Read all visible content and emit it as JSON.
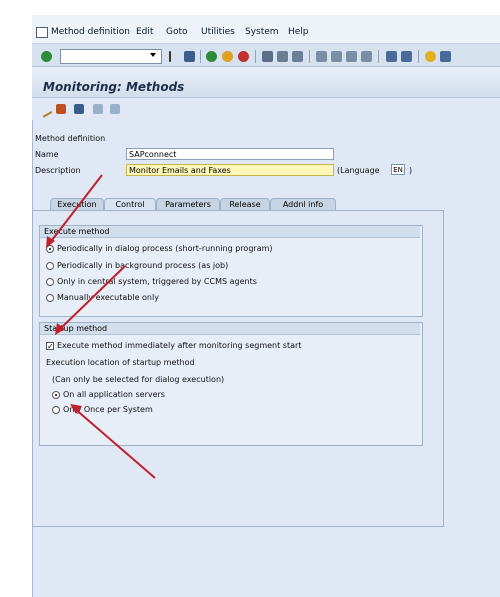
{
  "menu": {
    "items": [
      {
        "label": "Method definition",
        "underline": "e"
      },
      {
        "label": "Edit"
      },
      {
        "label": "Goto"
      },
      {
        "label": "Utilities"
      },
      {
        "label": "System"
      },
      {
        "label": "Help"
      }
    ]
  },
  "screen": {
    "title": "Monitoring: Methods"
  },
  "form": {
    "section_label": "Method definition",
    "name_label": "Name",
    "name_value": "SAPconnect",
    "description_label": "Description",
    "description_value": "Monitor Emails and Faxes",
    "language_label": "(Language",
    "language_value": "EN",
    "language_close": ")"
  },
  "tabs": [
    "Execution",
    "Control",
    "Parameters",
    "Release",
    "Addnl info"
  ],
  "active_tab": "Control",
  "execute_method": {
    "title": "Execute method",
    "options": [
      {
        "label": "Periodically in dialog process (short-running program)",
        "selected": true
      },
      {
        "label": "Periodically in background process (as job)",
        "selected": false
      },
      {
        "label": "Only in central system, triggered by CCMS agents",
        "selected": false
      },
      {
        "label": "Manually executable only",
        "selected": false
      }
    ]
  },
  "startup_method": {
    "title": "Startup method",
    "checkbox_label": "Execute method immediately after monitoring segment start",
    "checkbox_checked": true,
    "location_label": "Execution location of startup method",
    "note": "(Can only be selected for dialog execution)",
    "options": [
      {
        "label": "On all application servers",
        "selected": true
      },
      {
        "label": "Only Once per System",
        "selected": false
      }
    ]
  },
  "colors": {
    "annotation_arrow": "#c0202a",
    "required_field": "#fff8b8"
  }
}
